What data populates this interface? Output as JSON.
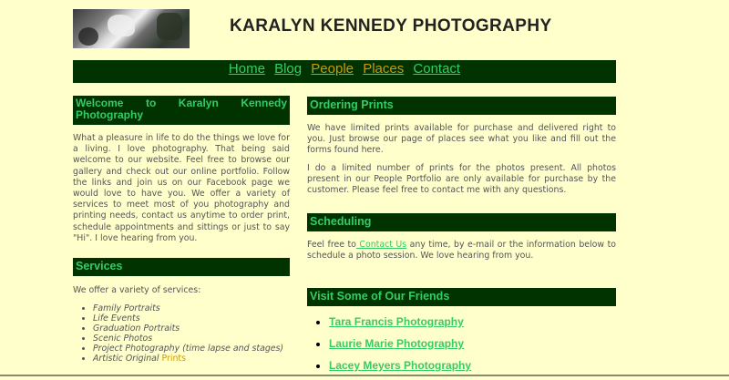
{
  "header": {
    "photo_icon": "header-photo",
    "title": "KARALYN KENNEDY PHOTOGRAPHY"
  },
  "nav": {
    "items": [
      {
        "label": "Home",
        "color": "#33cc66"
      },
      {
        "label": "Blog",
        "color": "#33cc66"
      },
      {
        "label": "People",
        "color": "#cc9900"
      },
      {
        "label": "Places",
        "color": "#cc9900"
      },
      {
        "label": "Contact",
        "color": "#33cc66"
      }
    ]
  },
  "welcome": {
    "heading": "Welcome to Karalyn Kennedy Photography",
    "body": "What a pleasure in life to do the things we love for a living. I love photography. That being said welcome to our website. Feel free to browse our gallery and check out our online portfolio. Follow the links and join us on our Facebook page we would love to have you. We offer a variety of services to meet most of you photography and printing needs, contact us anytime to order print, schedule appointments and sittings or just to say \"Hi\". I love hearing from you."
  },
  "services": {
    "heading": "Services",
    "intro": "We offer a variety of services:",
    "items": [
      "Family Portraits",
      "Life Events",
      "Graduation Portraits",
      "Scenic Photos",
      "Project Photography (time lapse and stages)"
    ],
    "last_item_prefix": "Artistic Original",
    "last_item_link": "Prints"
  },
  "ordering": {
    "heading": "Ordering Prints",
    "para1": "We have limited prints available for purchase and delivered right to you. Just browse our page of places see what you like and fill out the forms found here.",
    "para2": "I do a limited number of prints for the photos present. All photos present in our People Portfolio are only available for purchase by the customer. Please feel free to contact me with any questions."
  },
  "scheduling": {
    "heading": "Scheduling",
    "prefix": "Feel free to",
    "link": " Contact Us",
    "suffix": " any time, by e-mail or the information below to schedule a photo session. We love hearing from you."
  },
  "friends": {
    "heading": "Visit Some of Our Friends",
    "links": [
      "Tara Francis Photography",
      "Laurie Marie Photography",
      "Lacey Meyers Photography"
    ]
  },
  "colors": {
    "page_bg": "#ffffcc",
    "heading_bg": "#003300",
    "heading_text": "#33cc66",
    "accent_orange": "#cc9900"
  }
}
